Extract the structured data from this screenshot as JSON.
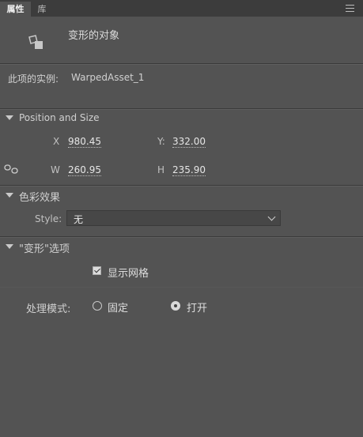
{
  "tabs": [
    {
      "label": "属性",
      "active": true
    },
    {
      "label": "库",
      "active": false
    }
  ],
  "object": {
    "type_label": "变形的对象",
    "instance_label": "此项的实例:",
    "instance_name": "WarpedAsset_1"
  },
  "position_size": {
    "header": "Position and Size",
    "x_label": "X",
    "x_value": "980.45",
    "y_label": "Y:",
    "y_value": "332.00",
    "w_label": "W",
    "w_value": "260.95",
    "h_label": "H",
    "h_value": "235.90"
  },
  "color_effect": {
    "header": "色彩效果",
    "style_label": "Style:",
    "style_value": "无"
  },
  "warp_options": {
    "header": "\"变形\"选项",
    "show_grid_label": "显示网格",
    "show_grid_checked": true,
    "mode_label": "处理模式:",
    "mode_options": [
      {
        "label": "固定",
        "selected": false
      },
      {
        "label": "打开",
        "selected": true
      }
    ]
  },
  "icons": [
    "panel-menu-icon",
    "warped-object-icon",
    "link-icon",
    "disclosure-triangle-icon",
    "chevron-down-icon",
    "checkbox",
    "radio"
  ],
  "colors": {
    "panel_bg": "#535353",
    "tab_bar_bg": "#3c3c3c",
    "text": "#d6d6d6"
  }
}
